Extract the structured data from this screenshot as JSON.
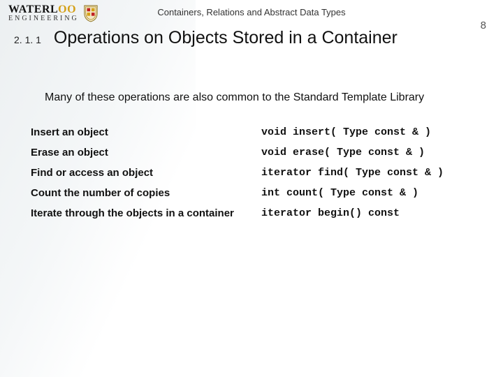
{
  "header": {
    "logo_top": "WATERLOO",
    "logo_bottom": "ENGINEERING",
    "chapter_title": "Containers, Relations and Abstract Data Types",
    "page_number": "8"
  },
  "section": {
    "number": "2. 1. 1",
    "title": "Operations on Objects Stored in a Container"
  },
  "intro_text": "Many of these operations are also common to the Standard Template Library",
  "operations": [
    {
      "desc": "Insert an object",
      "sig": "void insert( Type const & )"
    },
    {
      "desc": "Erase an object",
      "sig": "void erase( Type const & )"
    },
    {
      "desc": "Find or access an object",
      "sig": "iterator find( Type const & )"
    },
    {
      "desc": "Count the number of copies",
      "sig": "int count( Type const & )"
    },
    {
      "desc": "Iterate through the objects in a container",
      "sig": "iterator begin() const"
    }
  ]
}
